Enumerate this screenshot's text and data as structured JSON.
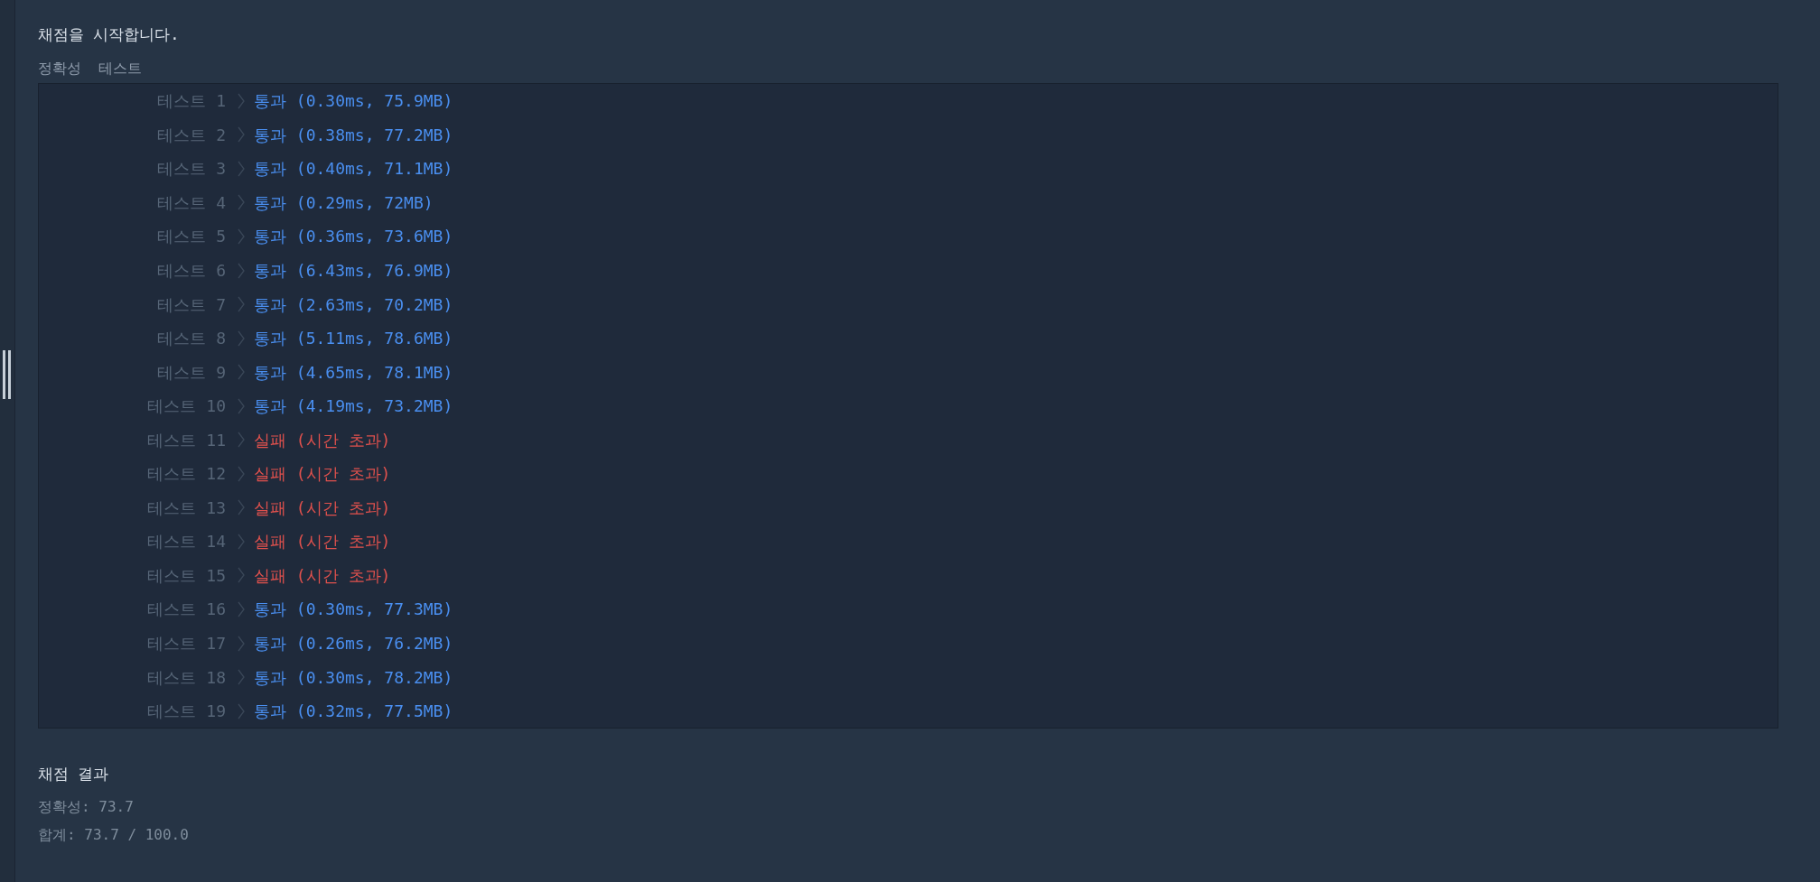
{
  "title": "채점을 시작합니다.",
  "section_title": "정확성  테스트",
  "tests": [
    {
      "label": "테스트 1",
      "result": "통과 (0.30ms, 75.9MB)",
      "passed": true
    },
    {
      "label": "테스트 2",
      "result": "통과 (0.38ms, 77.2MB)",
      "passed": true
    },
    {
      "label": "테스트 3",
      "result": "통과 (0.40ms, 71.1MB)",
      "passed": true
    },
    {
      "label": "테스트 4",
      "result": "통과 (0.29ms, 72MB)",
      "passed": true
    },
    {
      "label": "테스트 5",
      "result": "통과 (0.36ms, 73.6MB)",
      "passed": true
    },
    {
      "label": "테스트 6",
      "result": "통과 (6.43ms, 76.9MB)",
      "passed": true
    },
    {
      "label": "테스트 7",
      "result": "통과 (2.63ms, 70.2MB)",
      "passed": true
    },
    {
      "label": "테스트 8",
      "result": "통과 (5.11ms, 78.6MB)",
      "passed": true
    },
    {
      "label": "테스트 9",
      "result": "통과 (4.65ms, 78.1MB)",
      "passed": true
    },
    {
      "label": "테스트 10",
      "result": "통과 (4.19ms, 73.2MB)",
      "passed": true
    },
    {
      "label": "테스트 11",
      "result": "실패 (시간 초과)",
      "passed": false
    },
    {
      "label": "테스트 12",
      "result": "실패 (시간 초과)",
      "passed": false
    },
    {
      "label": "테스트 13",
      "result": "실패 (시간 초과)",
      "passed": false
    },
    {
      "label": "테스트 14",
      "result": "실패 (시간 초과)",
      "passed": false
    },
    {
      "label": "테스트 15",
      "result": "실패 (시간 초과)",
      "passed": false
    },
    {
      "label": "테스트 16",
      "result": "통과 (0.30ms, 77.3MB)",
      "passed": true
    },
    {
      "label": "테스트 17",
      "result": "통과 (0.26ms, 76.2MB)",
      "passed": true
    },
    {
      "label": "테스트 18",
      "result": "통과 (0.30ms, 78.2MB)",
      "passed": true
    },
    {
      "label": "테스트 19",
      "result": "통과 (0.32ms, 77.5MB)",
      "passed": true
    }
  ],
  "summary": {
    "title": "채점 결과",
    "lines": [
      "정확성: 73.7",
      "합계: 73.7 / 100.0"
    ]
  }
}
